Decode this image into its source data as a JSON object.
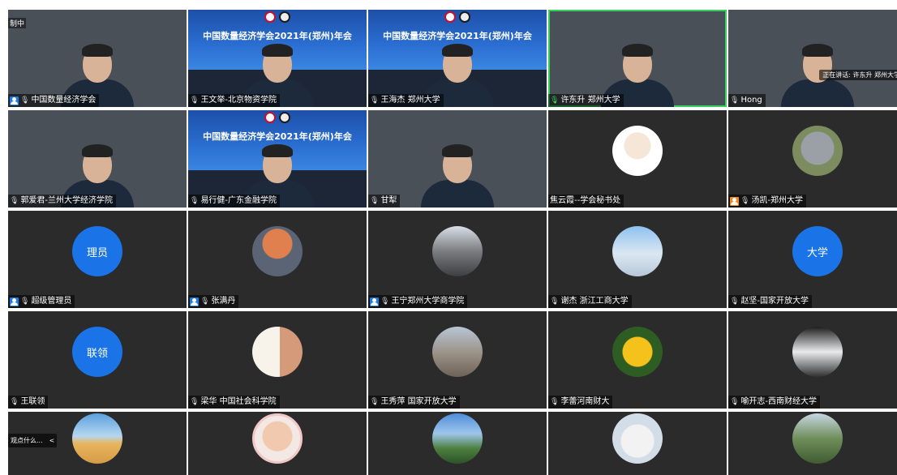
{
  "corner_label": "制中",
  "banner_title": "中国数量经济学会2021年(郑州)年会",
  "speaking_indicator": "正在讲话: 许东升 郑州大学",
  "chat_hint": {
    "text": "观点什么...",
    "arrow": "<"
  },
  "participants": [
    {
      "name": "中国数量经济学会",
      "host": true,
      "host_color": "#1e7be0",
      "mic": "muted",
      "kind": "video",
      "scene": "meeting"
    },
    {
      "name": "王文举-北京物资学院",
      "host": false,
      "mic": "muted",
      "kind": "video",
      "scene": "banner"
    },
    {
      "name": "王海杰 郑州大学",
      "host": false,
      "mic": "muted",
      "kind": "video",
      "scene": "banner"
    },
    {
      "name": "许东升 郑州大学",
      "host": false,
      "mic": "speaking",
      "kind": "video",
      "scene": "office",
      "speaking": true
    },
    {
      "name": "Hong",
      "host": false,
      "mic": "muted",
      "kind": "video",
      "scene": "outdoor"
    },
    {
      "name": "郭爱君-兰州大学经济学院",
      "host": false,
      "mic": "muted",
      "kind": "video",
      "scene": "light"
    },
    {
      "name": "易行健-广东金融学院",
      "host": false,
      "mic": "muted",
      "kind": "video",
      "scene": "banner"
    },
    {
      "name": "甘犁",
      "host": false,
      "mic": "muted",
      "kind": "video",
      "scene": "wood"
    },
    {
      "name": "焦云霞--学会秘书处",
      "host": false,
      "mic": "none",
      "kind": "avatar",
      "avatar": "girl"
    },
    {
      "name": "汤凯-郑州大学",
      "host": true,
      "host_color": "#f08b1d",
      "mic": "muted",
      "kind": "avatar",
      "avatar": "koala"
    },
    {
      "name": "超级管理员",
      "host": true,
      "host_color": "#1e7be0",
      "mic": "muted",
      "kind": "text",
      "avatar_text": "理员"
    },
    {
      "name": "张满丹",
      "host": true,
      "host_color": "#1e7be0",
      "mic": "muted",
      "kind": "avatar",
      "avatar": "moon"
    },
    {
      "name": "王宁郑州大学商学院",
      "host": true,
      "host_color": "#1e7be0",
      "mic": "muted",
      "kind": "avatar",
      "avatar": "city"
    },
    {
      "name": "谢杰 浙江工商大学",
      "host": false,
      "mic": "muted",
      "kind": "avatar",
      "avatar": "clouds"
    },
    {
      "name": "赵坚-国家开放大学",
      "host": false,
      "mic": "muted",
      "kind": "text",
      "avatar_text": "大学"
    },
    {
      "name": "王联领",
      "host": false,
      "mic": "muted",
      "kind": "text",
      "avatar_text": "联领"
    },
    {
      "name": "梁华 中国社会科学院",
      "host": false,
      "mic": "muted",
      "kind": "avatar",
      "avatar": "painting"
    },
    {
      "name": "王秀萍 国家开放大学",
      "host": false,
      "mic": "muted",
      "kind": "avatar",
      "avatar": "tower"
    },
    {
      "name": "李蕾河南财大",
      "host": false,
      "mic": "muted",
      "kind": "avatar",
      "avatar": "flower"
    },
    {
      "name": "喻开志-西南财经大学",
      "host": false,
      "mic": "muted",
      "kind": "avatar",
      "avatar": "car"
    },
    {
      "name": "",
      "host": false,
      "mic": "none",
      "kind": "avatar",
      "avatar": "beach"
    },
    {
      "name": "",
      "host": false,
      "mic": "none",
      "kind": "avatar",
      "avatar": "baby"
    },
    {
      "name": "",
      "host": false,
      "mic": "none",
      "kind": "avatar",
      "avatar": "mountain"
    },
    {
      "name": "",
      "host": false,
      "mic": "none",
      "kind": "avatar",
      "avatar": "cat"
    },
    {
      "name": "",
      "host": false,
      "mic": "none",
      "kind": "avatar",
      "avatar": "bridge"
    }
  ]
}
